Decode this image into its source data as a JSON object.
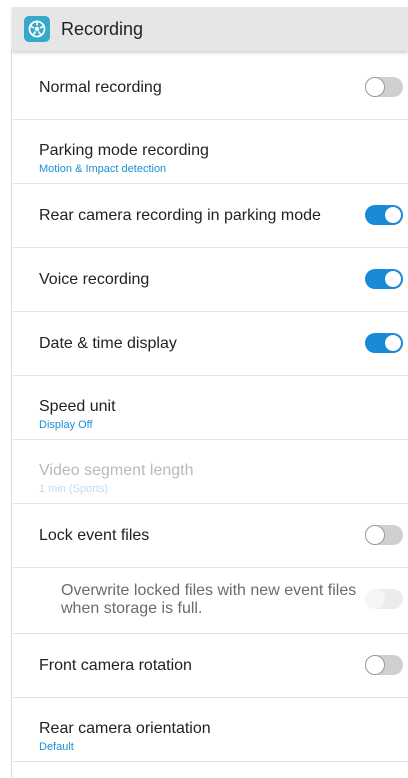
{
  "header": {
    "title": "Recording",
    "icon": "recording-app-icon",
    "accent": "#36a8c9"
  },
  "settings": [
    {
      "label": "Normal recording",
      "toggle": "off"
    },
    {
      "label": "Parking mode recording",
      "sub": "Motion & Impact detection"
    },
    {
      "label": "Rear camera recording in parking mode",
      "toggle": "on"
    },
    {
      "label": "Voice recording",
      "toggle": "on"
    },
    {
      "label": "Date & time display",
      "toggle": "on"
    },
    {
      "label": "Speed unit",
      "sub": "Display Off"
    },
    {
      "label": "Video segment length",
      "sub": "1 min (Sports)",
      "disabled": true
    },
    {
      "label": "Lock event files",
      "toggle": "off"
    },
    {
      "label": "Overwrite locked files with new event files when storage is full.",
      "toggle": "off",
      "disabled": true
    },
    {
      "label": "Front camera rotation",
      "toggle": "off"
    },
    {
      "label": "Rear camera orientation",
      "sub": "Default"
    }
  ],
  "colors": {
    "toggle_on": "#1a8ad8",
    "toggle_off": "#cfcfcf",
    "sub_text": "#1c8fd6"
  }
}
